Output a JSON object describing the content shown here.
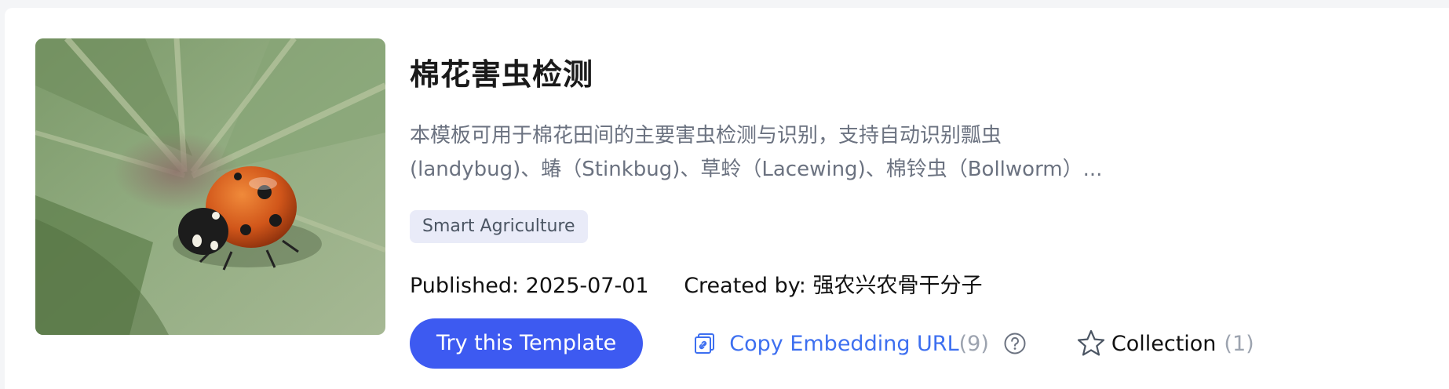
{
  "card": {
    "title": "棉花害虫检测",
    "description_line1": "本模板可用于棉花田间的主要害虫检测与识别，支持自动识别瓢虫",
    "description_line2": "(landybug)、蝽（Stinkbug)、草蛉（Lacewing)、棉铃虫（Bollworm）...",
    "tag": "Smart Agriculture",
    "published": "Published: 2025-07-01",
    "created_by": "Created by: 强农兴农骨干分子",
    "image_subject": "ladybug-on-leaf"
  },
  "actions": {
    "try_label": "Try this Template",
    "copy_label": "Copy Embedding URL",
    "copy_count": "(9)",
    "collection_label": "Collection",
    "collection_count": "(1)"
  },
  "icons": {
    "copy": "copy-link-icon",
    "help": "help-icon",
    "collection": "star-icon"
  },
  "colors": {
    "primary": "#3d5af1",
    "link": "#3d6ff0",
    "tag_bg": "#e9ebf8",
    "muted": "#9ca3af"
  }
}
